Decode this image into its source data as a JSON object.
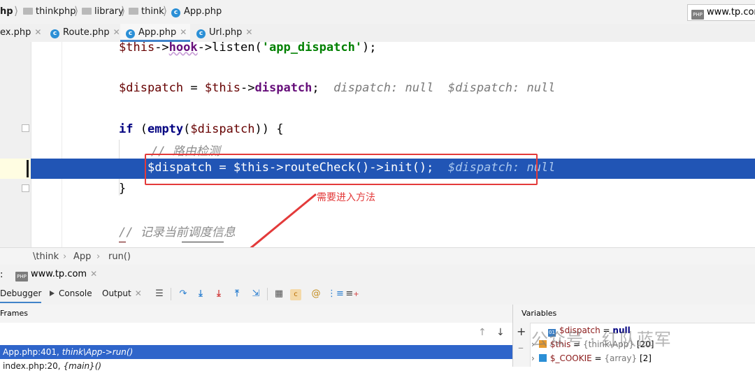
{
  "navbar": {
    "crumbs": [
      "hp",
      "thinkphp",
      "library",
      "think",
      "App.php"
    ],
    "run_config": "www.tp.com"
  },
  "tabs": [
    {
      "label": "ex.php",
      "active": false
    },
    {
      "label": "Route.php",
      "active": false
    },
    {
      "label": "App.php",
      "active": true
    },
    {
      "label": "Url.php",
      "active": false
    }
  ],
  "editor": {
    "line1": {
      "a": "$this",
      "b": "->",
      "c": "hook",
      "d": "->listen(",
      "e": "'app_dispatch'",
      "f": ");"
    },
    "line2": {
      "a": "$dispatch",
      "b": " = ",
      "c": "$this",
      "d": "->",
      "e": "dispatch",
      "f": ";",
      "hint": "dispatch: null  $dispatch: null"
    },
    "line3": {
      "kw": "if",
      "a": " (",
      "fn": "empty",
      "b": "(",
      "v": "$dispatch",
      "c": ")) {"
    },
    "line4": {
      "comment": "// 路由检测"
    },
    "line5": {
      "code": "$dispatch = $this->routeCheck()->init();",
      "hint": "$dispatch: null"
    },
    "line6": {
      "text": "}"
    },
    "line7": {
      "comment": "// 记录当前调度信息"
    }
  },
  "annotation": "需要进入方法",
  "pathbar": [
    "\\think",
    "App",
    "run()"
  ],
  "debug": {
    "title_prefix": ":",
    "config_name": "www.tp.com",
    "tabs": {
      "debugger": "Debugger",
      "console": "Console",
      "output": "Output"
    },
    "frames_label": "Frames",
    "variables_label": "Variables",
    "frames": [
      {
        "file": "App.php:401, ",
        "method": "think\\App->run()",
        "selected": true
      },
      {
        "file": "index.php:20, ",
        "method": "{main}()",
        "selected": false
      }
    ],
    "variables": [
      {
        "name": "$dispatch",
        "eq": " = ",
        "value": "null"
      },
      {
        "name": "$this",
        "eq": " = ",
        "type": "{think\\App}",
        "value": " [20]"
      },
      {
        "name": "$_COOKIE",
        "eq": " = ",
        "type": "{array}",
        "value": " [2]"
      }
    ]
  },
  "watermark": "公众号 · 红队蓝军",
  "colors": {
    "highlight": "#2155b5",
    "annotation": "#e33a3a",
    "tab_underline": "#4083c9"
  }
}
